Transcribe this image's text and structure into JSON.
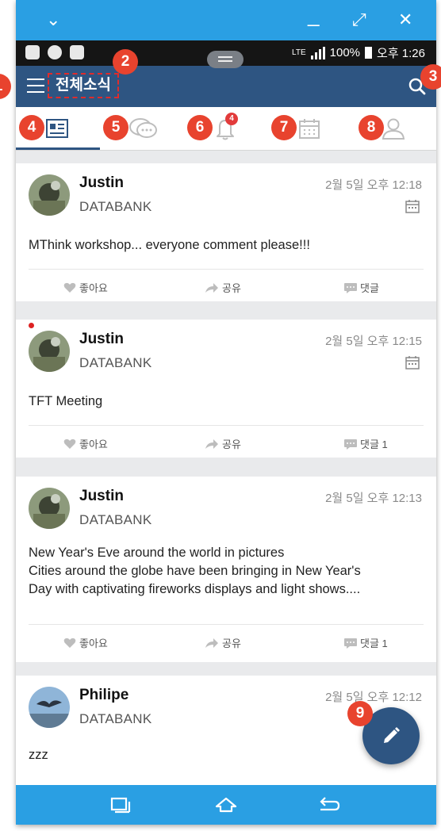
{
  "callouts": [
    "1",
    "2",
    "3",
    "4",
    "5",
    "6",
    "7",
    "8",
    "9"
  ],
  "window_controls": {
    "collapse": "⌄",
    "minimize": "_",
    "expand": "⤢",
    "close": "✕"
  },
  "status_bar": {
    "network": "LTE",
    "battery": "100%",
    "time": "오후 1:26"
  },
  "app_bar": {
    "title": "전체소식"
  },
  "tabs": [
    {
      "name": "news",
      "icon": "news-icon",
      "active": true
    },
    {
      "name": "messages",
      "icon": "chat-icon",
      "active": false
    },
    {
      "name": "notifications",
      "icon": "bell-icon",
      "active": false,
      "badge": "4"
    },
    {
      "name": "calendar",
      "icon": "calendar-icon",
      "active": false
    },
    {
      "name": "profile",
      "icon": "person-icon",
      "active": false
    }
  ],
  "posts": [
    {
      "author": "Justin",
      "org": "DATABANK",
      "time": "2월 5일 오후 12:18",
      "text": "MThink workshop... everyone comment please!!!",
      "like_label": "좋아요",
      "share_label": "공유",
      "comment_label": "댓글"
    },
    {
      "author": "Justin",
      "org": "DATABANK",
      "time": "2월 5일 오후 12:15",
      "text": "TFT Meeting",
      "like_label": "좋아요",
      "share_label": "공유",
      "comment_label": "댓글 1"
    },
    {
      "author": "Justin",
      "org": "DATABANK",
      "time": "2월 5일 오후 12:13",
      "text_line1": "New Year's Eve around the world in pictures",
      "text_line2": "Cities around the globe have been bringing in New Year's",
      "text_line3": "Day with captivating fireworks displays and light shows....",
      "like_label": "좋아요",
      "share_label": "공유",
      "comment_label": "댓글 1"
    },
    {
      "author": "Philipe",
      "org": "DATABANK",
      "time": "2월 5일 오후 12:12",
      "text": "zzz"
    }
  ],
  "colors": {
    "app_bar": "#2e5582",
    "window_bar": "#2a9fe3",
    "callout": "#e8432e",
    "badge": "#e23b3b"
  }
}
